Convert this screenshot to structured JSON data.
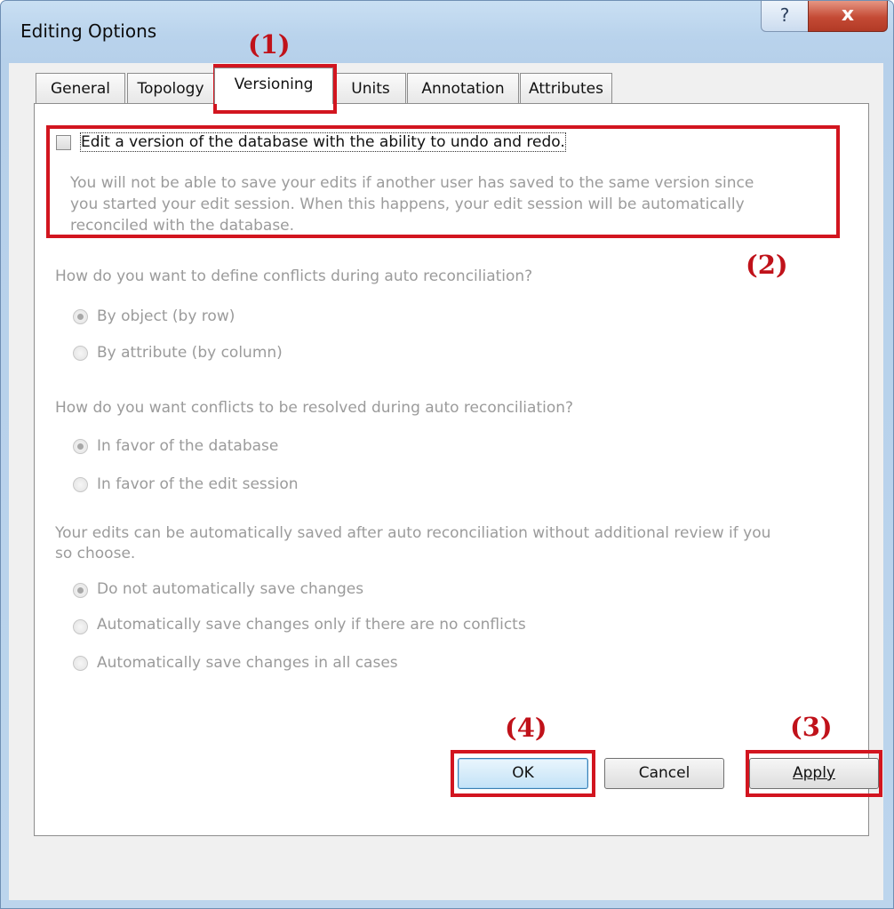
{
  "window": {
    "title": "Editing Options",
    "help_label": "?",
    "close_label": "x"
  },
  "tabs": [
    {
      "label": "General"
    },
    {
      "label": "Topology"
    },
    {
      "label": "Versioning"
    },
    {
      "label": "Units"
    },
    {
      "label": "Annotation"
    },
    {
      "label": "Attributes"
    }
  ],
  "active_tab": "Versioning",
  "versioning": {
    "undo_redo": {
      "label": "Edit a version of the database with the ability to undo and redo.",
      "checked": false,
      "description": [
        "You will not be able to save your edits if another user has saved to the same version since",
        "you started your edit session. When this happens, your edit session will be automatically",
        "reconciled with the database."
      ]
    },
    "conflict_definition": {
      "question": "How do you want to define conflicts during auto reconciliation?",
      "options": [
        {
          "label": "By object (by row)",
          "selected": true
        },
        {
          "label": "By attribute (by column)",
          "selected": false
        }
      ]
    },
    "conflict_resolution": {
      "question": "How do you want conflicts to be resolved during auto reconciliation?",
      "options": [
        {
          "label": "In favor of the database",
          "selected": true
        },
        {
          "label": "In favor of the edit session",
          "selected": false
        }
      ]
    },
    "auto_save": {
      "question": [
        "Your edits can be automatically saved after auto reconciliation without additional review if you",
        "so choose."
      ],
      "options": [
        {
          "label": "Do not automatically save changes",
          "selected": true
        },
        {
          "label": "Automatically save changes only if there are no conflicts",
          "selected": false
        },
        {
          "label": "Automatically save changes in all cases",
          "selected": false
        }
      ]
    }
  },
  "buttons": {
    "ok": "OK",
    "cancel": "Cancel",
    "apply": "Apply"
  },
  "annotations": [
    "(1)",
    "(2)",
    "(3)",
    "(4)"
  ],
  "colors": {
    "annotation_red": "#d2151f",
    "disabled_text": "#9b9b9b",
    "title_bar": "#b9d3ec"
  }
}
